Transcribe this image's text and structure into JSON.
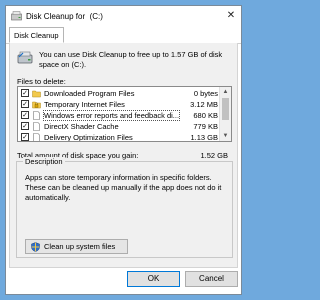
{
  "window": {
    "title": "Disk Cleanup for  (C:)",
    "close_glyph": "✕"
  },
  "tabs": [
    {
      "label": "Disk Cleanup",
      "selected": true
    }
  ],
  "intro_text": "You can use Disk Cleanup to free up to 1.57 GB of disk space on  (C:).",
  "files_label": "Files to delete:",
  "files": [
    {
      "name": "Downloaded Program Files",
      "size": "0 bytes",
      "checked": true,
      "icon": "folder-icon"
    },
    {
      "name": "Temporary Internet Files",
      "size": "3.12 MB",
      "checked": true,
      "icon": "lock-folder-icon"
    },
    {
      "name": "Windows error reports and feedback di...",
      "size": "680 KB",
      "checked": true,
      "icon": "document-icon",
      "selected": true
    },
    {
      "name": "DirectX Shader Cache",
      "size": "779 KB",
      "checked": true,
      "icon": "document-icon"
    },
    {
      "name": "Delivery Optimization Files",
      "size": "1.13 GB",
      "checked": true,
      "icon": "document-icon"
    }
  ],
  "check_glyph": "✓",
  "total_label": "Total amount of disk space you gain:",
  "total_value": "1.52 GB",
  "description": {
    "title": "Description",
    "text": "Apps can store temporary information in specific folders. These can be cleaned up manually if the app does not do it automatically."
  },
  "cleanup_button": "Clean up system files",
  "ok_button": "OK",
  "cancel_button": "Cancel",
  "colors": {
    "background": "#6fa9dd",
    "accent": "#0078d7"
  }
}
